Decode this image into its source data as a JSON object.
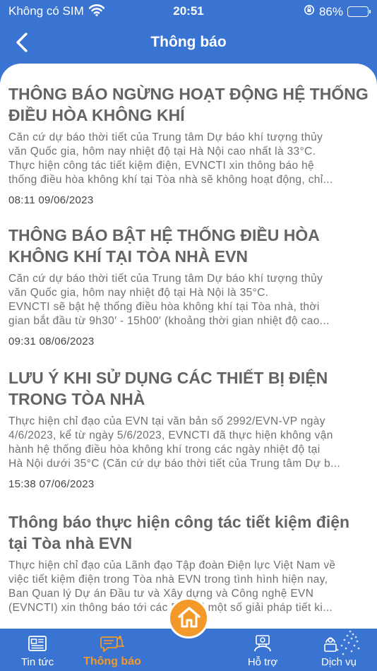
{
  "status_bar": {
    "carrier": "Không có SIM",
    "time": "20:51",
    "battery": "86%",
    "battery_level": 0.86
  },
  "header": {
    "title": "Thông báo"
  },
  "notices": [
    {
      "title_lines": [
        "THÔNG BÁO NGỪNG HOẠT ĐỘNG HỆ THỐNG",
        "ĐIỀU HÒA KHÔNG KHÍ"
      ],
      "body_lines": [
        "Căn cứ dự báo thời tiết của Trung tâm Dự báo khí tượng thủy",
        "văn Quốc gia, hôm nay nhiệt độ tại Hà Nội cao nhất là 33°C.",
        "Thực hiện công tác tiết kiệm điện, EVNCTI xin thông báo hệ",
        "thống điều hòa không khí tại Tòa nhà sẽ không hoạt động, chỉ..."
      ],
      "time": "08:11 09/06/2023"
    },
    {
      "title_lines": [
        "THÔNG BÁO BẬT HỆ THỐNG ĐIỀU HÒA",
        "KHÔNG KHÍ TẠI TÒA NHÀ EVN"
      ],
      "body_lines": [
        "Căn cứ dự báo thời tiết của Trung tâm Dự báo khí tượng thủy",
        "văn Quốc gia, hôm nay nhiệt độ tại Hà Nội là 35°C.",
        "EVNCTI sẽ bật hệ thống điều hòa không khí tại Tòa nhà, thời",
        "gian bắt đầu từ 9h30′ - 15h00′ (khoảng thời gian nhiệt độ cao..."
      ],
      "time": "09:31 08/06/2023"
    },
    {
      "title_lines": [
        "LƯU Ý KHI SỬ DỤNG CÁC THIẾT BỊ ĐIỆN",
        "TRONG TÒA NHÀ"
      ],
      "body_lines": [
        " Thực hiện chỉ đạo của EVN tại văn bản số 2992/EVN-VP ngày",
        "4/6/2023, kể từ ngày 5/6/2023, EVNCTI đã thực hiện không vận",
        "hành hệ thống điều hòa không khí trong các ngày nhiệt độ tại",
        "Hà Nội dưới 35°C (Căn cứ dự báo thời tiết của Trung tâm Dự b..."
      ],
      "time": "15:38 07/06/2023"
    },
    {
      "title_lines": [
        "Thông báo thực hiện công tác tiết kiệm điện",
        "tại Tòa nhà EVN"
      ],
      "body_lines": [
        "Thực hiện chỉ đạo của Lãnh đạo Tập đoàn Điện lực Việt Nam về",
        "việc tiết kiệm điện trong Tòa nhà EVN trong tình hình hiện nay,",
        "Ban Quan lý Dự án Đầu tư và Xây dựng và Công nghệ EVN",
        "(EVNCTI) xin thông báo tới các Đơn vị một số giải pháp tiết ki..."
      ],
      "time": ""
    }
  ],
  "bottom_nav": {
    "items": [
      {
        "label": "Tin tức",
        "icon": "newspaper-icon"
      },
      {
        "label": "Thông báo",
        "icon": "notification-bell-icon",
        "active": true
      },
      {
        "label": "Hỗ trợ",
        "icon": "support-agent-icon"
      },
      {
        "label": "Dịch vụ",
        "icon": "services-network-icon"
      }
    ],
    "home_icon": "home-icon"
  },
  "colors": {
    "primary": "#3a74d2",
    "accent": "#f2992a",
    "title_text": "#646464",
    "body_text": "#707070"
  }
}
